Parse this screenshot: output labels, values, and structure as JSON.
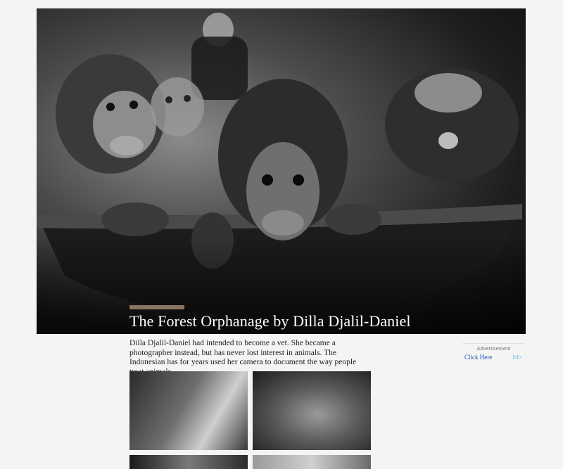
{
  "hero": {
    "title": "The Forest Orphanage by Dilla Djalil-Daniel",
    "accent_color": "#8a7561"
  },
  "intro": {
    "text": "Dilla Djalil-Daniel had intended to become a vet. She became a photographer instead, but has never lost interest in animals. The Indonesian has for years used her camera to document the way people treat animals."
  },
  "ad": {
    "label": "Advertisement",
    "link": "Click Here",
    "choices_icon": "ad-choices-icon"
  }
}
